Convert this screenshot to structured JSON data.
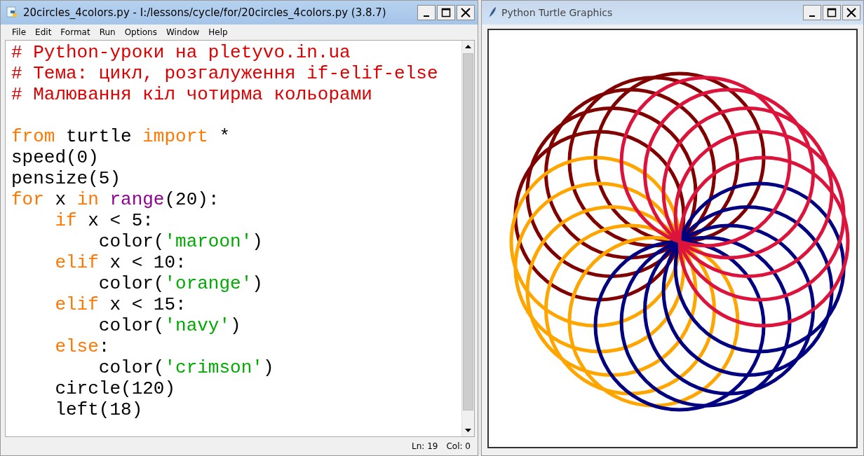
{
  "editor_window": {
    "title": "20circles_4colors.py - I:/lessons/cycle/for/20circles_4colors.py (3.8.7)",
    "menu": [
      "File",
      "Edit",
      "Format",
      "Run",
      "Options",
      "Window",
      "Help"
    ],
    "code_lines": [
      {
        "kind": "code",
        "tokens": [
          {
            "text": "# Python-уроки на pletyvo.in.ua",
            "kind": "comment"
          }
        ]
      },
      {
        "kind": "code",
        "tokens": [
          {
            "text": "# Тема: цикл, розгалуження if-elif-else",
            "kind": "comment"
          }
        ]
      },
      {
        "kind": "code",
        "tokens": [
          {
            "text": "# Малювання кіл чотирма кольорами",
            "kind": "comment"
          }
        ]
      },
      {
        "kind": "blank"
      },
      {
        "kind": "code",
        "tokens": [
          {
            "text": "from",
            "kind": "keyword"
          },
          {
            "text": " turtle ",
            "kind": "plain"
          },
          {
            "text": "import",
            "kind": "keyword"
          },
          {
            "text": " *",
            "kind": "plain"
          }
        ]
      },
      {
        "kind": "code",
        "tokens": [
          {
            "text": "speed(0)",
            "kind": "plain"
          }
        ]
      },
      {
        "kind": "code",
        "tokens": [
          {
            "text": "pensize(5)",
            "kind": "plain"
          }
        ]
      },
      {
        "kind": "code",
        "tokens": [
          {
            "text": "for",
            "kind": "keyword"
          },
          {
            "text": " x ",
            "kind": "plain"
          },
          {
            "text": "in",
            "kind": "keyword"
          },
          {
            "text": " range",
            "kind": "builtin"
          },
          {
            "text": "(20):",
            "kind": "plain"
          }
        ]
      },
      {
        "kind": "code",
        "tokens": [
          {
            "text": "    if",
            "kind": "keyword"
          },
          {
            "text": " x < 5:",
            "kind": "plain"
          }
        ]
      },
      {
        "kind": "code",
        "tokens": [
          {
            "text": "        color(",
            "kind": "plain"
          },
          {
            "text": "'maroon'",
            "kind": "string"
          },
          {
            "text": ")",
            "kind": "plain"
          }
        ]
      },
      {
        "kind": "code",
        "tokens": [
          {
            "text": "    elif",
            "kind": "keyword"
          },
          {
            "text": " x < 10:",
            "kind": "plain"
          }
        ]
      },
      {
        "kind": "code",
        "tokens": [
          {
            "text": "        color(",
            "kind": "plain"
          },
          {
            "text": "'orange'",
            "kind": "string"
          },
          {
            "text": ")",
            "kind": "plain"
          }
        ]
      },
      {
        "kind": "code",
        "tokens": [
          {
            "text": "    elif",
            "kind": "keyword"
          },
          {
            "text": " x < 15:",
            "kind": "plain"
          }
        ]
      },
      {
        "kind": "code",
        "tokens": [
          {
            "text": "        color(",
            "kind": "plain"
          },
          {
            "text": "'navy'",
            "kind": "string"
          },
          {
            "text": ")",
            "kind": "plain"
          }
        ]
      },
      {
        "kind": "code",
        "tokens": [
          {
            "text": "    else",
            "kind": "keyword"
          },
          {
            "text": ":",
            "kind": "plain"
          }
        ]
      },
      {
        "kind": "code",
        "tokens": [
          {
            "text": "        color(",
            "kind": "plain"
          },
          {
            "text": "'crimson'",
            "kind": "string"
          },
          {
            "text": ")",
            "kind": "plain"
          }
        ]
      },
      {
        "kind": "code",
        "tokens": [
          {
            "text": "    circle(120)",
            "kind": "plain"
          }
        ]
      },
      {
        "kind": "code",
        "tokens": [
          {
            "text": "    left(18)",
            "kind": "plain"
          }
        ]
      }
    ],
    "status": {
      "line": "Ln: 19",
      "column": "Col: 0"
    }
  },
  "turtle_window": {
    "title": "Python Turtle Graphics"
  }
}
